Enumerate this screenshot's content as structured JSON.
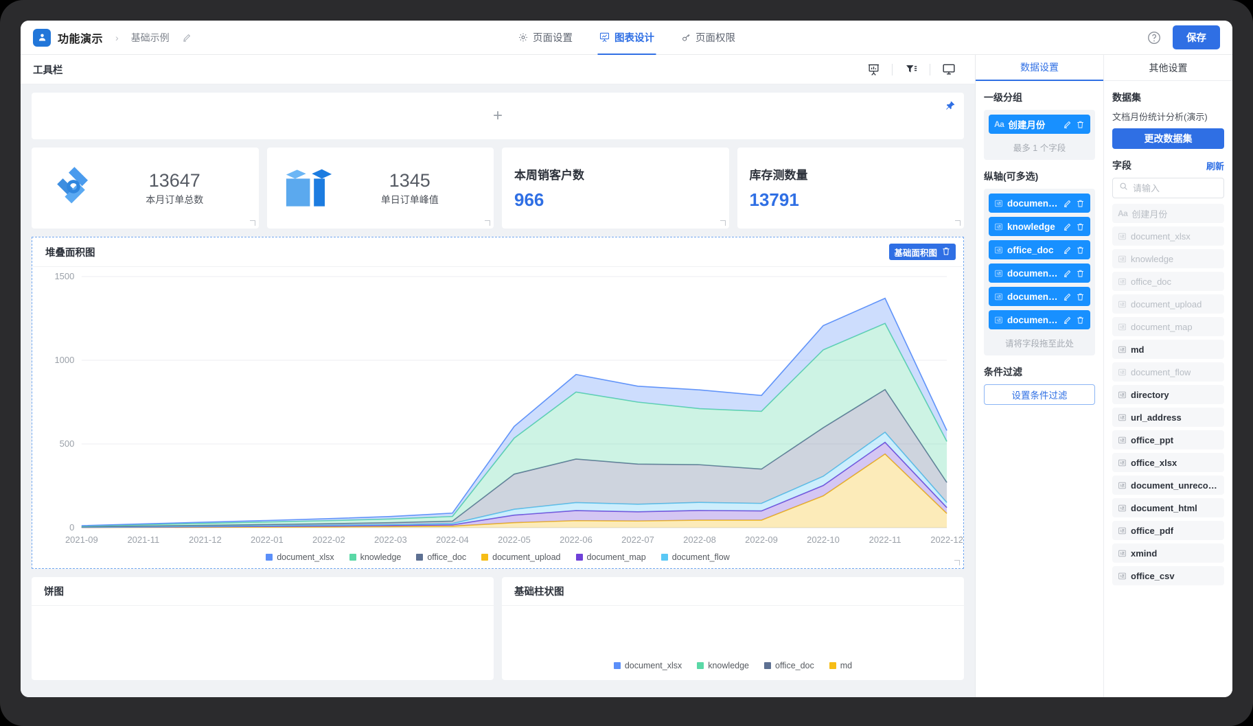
{
  "header": {
    "brand_title": "功能演示",
    "breadcrumb_separator": "›",
    "breadcrumb_second": "基础示例",
    "tabs": [
      {
        "label": "页面设置",
        "icon": "gear-icon",
        "active": false
      },
      {
        "label": "图表设计",
        "icon": "chart-board-icon",
        "active": true
      },
      {
        "label": "页面权限",
        "icon": "key-icon",
        "active": false
      }
    ],
    "help_label": "?",
    "save_label": "保存",
    "accent_color": "#2f6fe4"
  },
  "toolbar": {
    "title": "工具栏",
    "icons": [
      "presentation-icon",
      "filter-icon",
      "monitor-icon"
    ]
  },
  "canvas": {
    "add_zone": {
      "plus": "+",
      "pin": "pin-icon"
    },
    "kpis": [
      {
        "type": "icon-number",
        "icon": "logo-shape-icon",
        "value": "13647",
        "caption": "本月订单总数"
      },
      {
        "type": "icon-number",
        "icon": "gift-box-icon",
        "value": "1345",
        "caption": "单日订单峰值"
      },
      {
        "type": "title-value",
        "title": "本周销客户数",
        "value": "966"
      },
      {
        "type": "title-value",
        "title": "库存测数量",
        "value": "13791"
      }
    ],
    "area_widget": {
      "title": "堆叠面积图",
      "tag_label": "基础面积图",
      "tag_delete_icon": "trash-icon"
    },
    "bottom_widgets": [
      {
        "title": "饼图"
      },
      {
        "title": "基础柱状图",
        "legend": [
          "document_xlsx",
          "knowledge",
          "office_doc",
          "md"
        ],
        "legend_colors": [
          "#5b8ff9",
          "#5ad8a6",
          "#5d7092",
          "#f6bd16"
        ]
      }
    ]
  },
  "chart_data": {
    "type": "area",
    "title": "堆叠面积图",
    "stacked": true,
    "xlabel": "",
    "ylabel": "",
    "ylim": [
      0,
      1500
    ],
    "yticks": [
      0,
      500,
      1000,
      1500
    ],
    "grid": true,
    "legend_position": "bottom",
    "categories": [
      "2021-09",
      "2021-11",
      "2021-12",
      "2022-01",
      "2022-02",
      "2022-03",
      "2022-04",
      "2022-05",
      "2022-06",
      "2022-07",
      "2022-08",
      "2022-09",
      "2022-10",
      "2022-11",
      "2022-12"
    ],
    "series": [
      {
        "name": "document_xlsx",
        "color": "#5b8ff9",
        "values": [
          3,
          5,
          7,
          9,
          12,
          15,
          20,
          70,
          105,
          95,
          112,
          95,
          145,
          150,
          65
        ]
      },
      {
        "name": "knowledge",
        "color": "#5ad8a6",
        "values": [
          4,
          8,
          12,
          15,
          18,
          22,
          28,
          215,
          400,
          370,
          335,
          345,
          465,
          395,
          245
        ]
      },
      {
        "name": "office_doc",
        "color": "#5d7092",
        "values": [
          2,
          4,
          5,
          7,
          9,
          11,
          14,
          210,
          260,
          240,
          225,
          205,
          290,
          255,
          120
        ]
      },
      {
        "name": "document_upload",
        "color": "#f6bd16",
        "values": [
          1,
          2,
          3,
          4,
          5,
          7,
          9,
          30,
          42,
          40,
          45,
          45,
          190,
          440,
          85
        ]
      },
      {
        "name": "document_map",
        "color": "#6f41d8",
        "values": [
          1,
          2,
          3,
          4,
          5,
          6,
          8,
          45,
          60,
          55,
          58,
          55,
          62,
          70,
          35
        ]
      },
      {
        "name": "document_flow",
        "color": "#5ac8f5",
        "values": [
          1,
          2,
          3,
          4,
          5,
          6,
          8,
          35,
          48,
          45,
          48,
          45,
          55,
          60,
          30
        ]
      }
    ],
    "legend": [
      "document_xlsx",
      "knowledge",
      "office_doc",
      "document_upload",
      "document_map",
      "document_flow"
    ]
  },
  "right": {
    "tab_data_settings": "数据设置",
    "tab_other_settings": "其他设置",
    "group_section_title": "一级分组",
    "group_chips": [
      {
        "label": "创建月份",
        "icon": "text-field-icon"
      }
    ],
    "group_hint": "最多 1 个字段",
    "yaxis_section_title": "纵轴(可多选)",
    "yaxis_chips": [
      {
        "label": "document_...",
        "icon": "number-field-icon"
      },
      {
        "label": "knowledge",
        "icon": "number-field-icon"
      },
      {
        "label": "office_doc",
        "icon": "number-field-icon"
      },
      {
        "label": "document_...",
        "icon": "number-field-icon"
      },
      {
        "label": "document_...",
        "icon": "number-field-icon"
      },
      {
        "label": "document_...",
        "icon": "number-field-icon"
      }
    ],
    "yaxis_hint": "请将字段拖至此处",
    "filter_section_title": "条件过滤",
    "filter_button": "设置条件过滤",
    "chip_edit_icon": "pencil-icon",
    "chip_delete_icon": "trash-icon",
    "dataset_section_title": "数据集",
    "dataset_name": "文档月份统计分析(演示)",
    "change_dataset_button": "更改数据集",
    "fields_section_title": "字段",
    "refresh_label": "刷新",
    "search_placeholder": "请输入",
    "search_value": "",
    "search_icon": "search-icon",
    "fields": [
      {
        "label": "创建月份",
        "icon": "text-field-icon",
        "used": true
      },
      {
        "label": "document_xlsx",
        "icon": "number-field-icon",
        "used": true
      },
      {
        "label": "knowledge",
        "icon": "number-field-icon",
        "used": true
      },
      {
        "label": "office_doc",
        "icon": "number-field-icon",
        "used": true
      },
      {
        "label": "document_upload",
        "icon": "number-field-icon",
        "used": true
      },
      {
        "label": "document_map",
        "icon": "number-field-icon",
        "used": true
      },
      {
        "label": "md",
        "icon": "number-field-icon",
        "used": false
      },
      {
        "label": "document_flow",
        "icon": "number-field-icon",
        "used": true
      },
      {
        "label": "directory",
        "icon": "number-field-icon",
        "used": false
      },
      {
        "label": "url_address",
        "icon": "number-field-icon",
        "used": false
      },
      {
        "label": "office_ppt",
        "icon": "number-field-icon",
        "used": false
      },
      {
        "label": "office_xlsx",
        "icon": "number-field-icon",
        "used": false
      },
      {
        "label": "document_unrecog...",
        "icon": "number-field-icon",
        "used": false
      },
      {
        "label": "document_html",
        "icon": "number-field-icon",
        "used": false
      },
      {
        "label": "office_pdf",
        "icon": "number-field-icon",
        "used": false
      },
      {
        "label": "xmind",
        "icon": "number-field-icon",
        "used": false
      },
      {
        "label": "office_csv",
        "icon": "number-field-icon",
        "used": false
      }
    ]
  }
}
